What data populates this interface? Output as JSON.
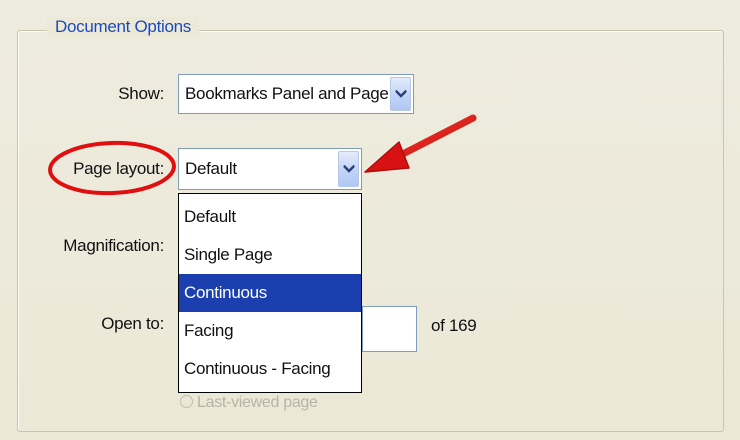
{
  "group": {
    "title": "Document Options"
  },
  "show": {
    "label": "Show:",
    "value": "Bookmarks Panel and Page"
  },
  "page_layout": {
    "label": "Page layout:",
    "value": "Default",
    "options": [
      "Default",
      "Single Page",
      "Continuous",
      "Facing",
      "Continuous - Facing"
    ],
    "highlighted": "Continuous"
  },
  "magnification": {
    "label": "Magnification:"
  },
  "open_to": {
    "label": "Open to:",
    "page_value": "",
    "of_pages": "of 169"
  },
  "radio": {
    "label": "Last-viewed page"
  },
  "colors": {
    "title_blue": "#1a4bbd",
    "highlight": "#1c3fb0",
    "annotation_red": "#e01010"
  },
  "icons": {
    "dropdown": "chevron-down-icon",
    "annotation_arrow": "red-arrow-icon",
    "annotation_circle": "red-ellipse-icon"
  }
}
